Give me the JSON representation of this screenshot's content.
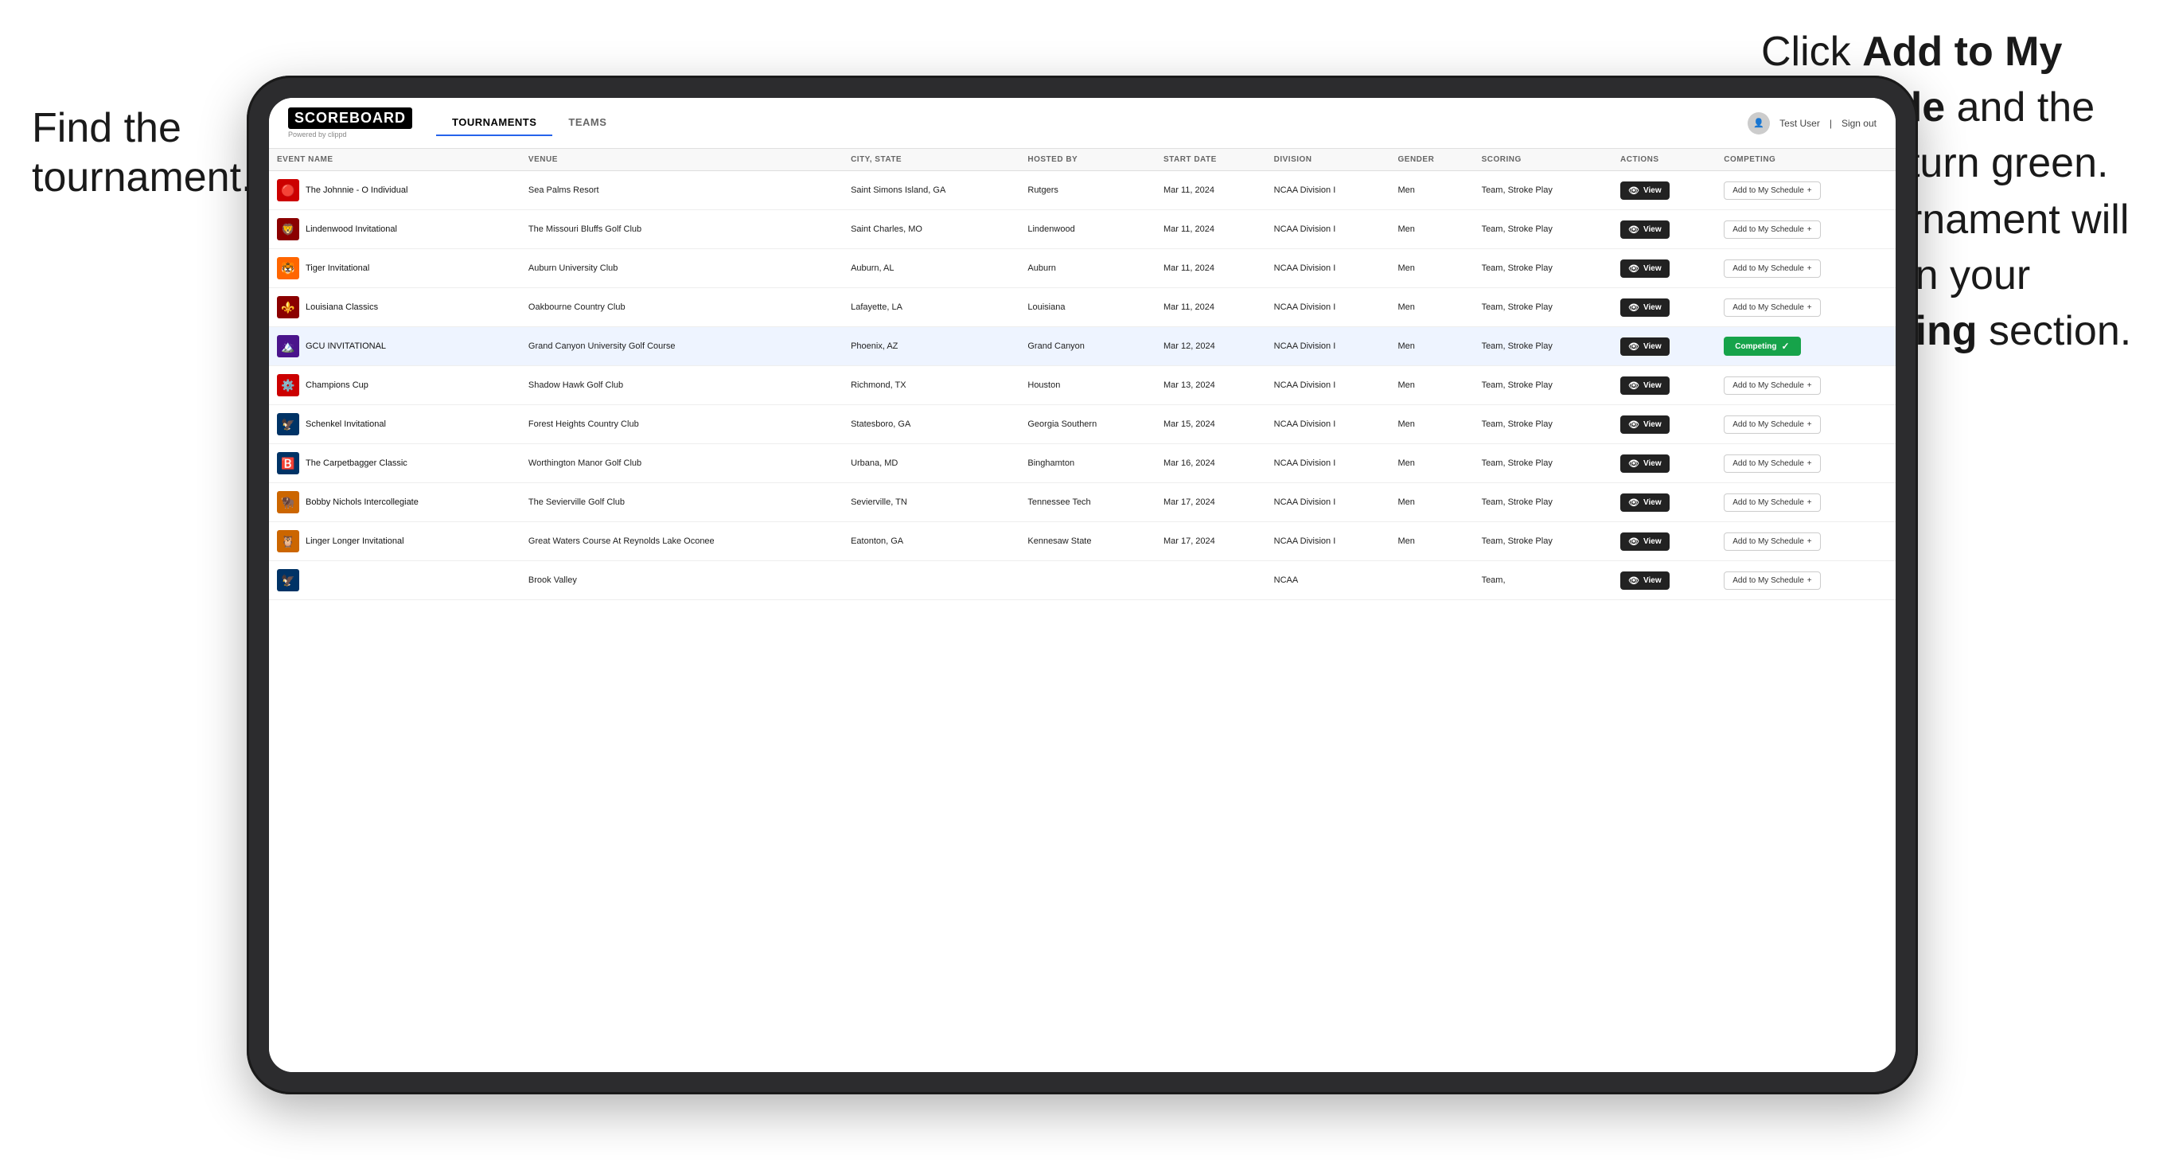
{
  "annotations": {
    "left": "Find the\ntournament.",
    "right_line1": "Click ",
    "right_bold1": "Add to My\nSchedule",
    "right_line2": " and the\nbox will turn green.\nThis tournament\nwill now be in\nyour ",
    "right_bold2": "Competing",
    "right_line3": " section."
  },
  "header": {
    "logo": "SCOREBOARD",
    "logo_sub": "Powered by clippd",
    "nav_tabs": [
      "TOURNAMENTS",
      "TEAMS"
    ],
    "active_tab": "TOURNAMENTS",
    "user": "Test User",
    "sign_out": "Sign out"
  },
  "table": {
    "columns": [
      "EVENT NAME",
      "VENUE",
      "CITY, STATE",
      "HOSTED BY",
      "START DATE",
      "DIVISION",
      "GENDER",
      "SCORING",
      "ACTIONS",
      "COMPETING"
    ],
    "rows": [
      {
        "logo_emoji": "🔴",
        "logo_bg": "#cc0000",
        "name": "The Johnnie - O Individual",
        "venue": "Sea Palms Resort",
        "city_state": "Saint Simons Island, GA",
        "hosted_by": "Rutgers",
        "start_date": "Mar 11, 2024",
        "division": "NCAA Division I",
        "gender": "Men",
        "scoring": "Team, Stroke Play",
        "status": "add",
        "highlighted": false
      },
      {
        "logo_emoji": "🦁",
        "logo_bg": "#8b0000",
        "name": "Lindenwood Invitational",
        "venue": "The Missouri Bluffs Golf Club",
        "city_state": "Saint Charles, MO",
        "hosted_by": "Lindenwood",
        "start_date": "Mar 11, 2024",
        "division": "NCAA Division I",
        "gender": "Men",
        "scoring": "Team, Stroke Play",
        "status": "add",
        "highlighted": false
      },
      {
        "logo_emoji": "🐯",
        "logo_bg": "#ff6600",
        "name": "Tiger Invitational",
        "venue": "Auburn University Club",
        "city_state": "Auburn, AL",
        "hosted_by": "Auburn",
        "start_date": "Mar 11, 2024",
        "division": "NCAA Division I",
        "gender": "Men",
        "scoring": "Team, Stroke Play",
        "status": "add",
        "highlighted": false
      },
      {
        "logo_emoji": "⚜️",
        "logo_bg": "#8b0000",
        "name": "Louisiana Classics",
        "venue": "Oakbourne Country Club",
        "city_state": "Lafayette, LA",
        "hosted_by": "Louisiana",
        "start_date": "Mar 11, 2024",
        "division": "NCAA Division I",
        "gender": "Men",
        "scoring": "Team, Stroke Play",
        "status": "add",
        "highlighted": false
      },
      {
        "logo_emoji": "🏔️",
        "logo_bg": "#4a148c",
        "name": "GCU INVITATIONAL",
        "venue": "Grand Canyon University Golf Course",
        "city_state": "Phoenix, AZ",
        "hosted_by": "Grand Canyon",
        "start_date": "Mar 12, 2024",
        "division": "NCAA Division I",
        "gender": "Men",
        "scoring": "Team, Stroke Play",
        "status": "competing",
        "highlighted": true
      },
      {
        "logo_emoji": "⚙️",
        "logo_bg": "#cc0000",
        "name": "Champions Cup",
        "venue": "Shadow Hawk Golf Club",
        "city_state": "Richmond, TX",
        "hosted_by": "Houston",
        "start_date": "Mar 13, 2024",
        "division": "NCAA Division I",
        "gender": "Men",
        "scoring": "Team, Stroke Play",
        "status": "add",
        "highlighted": false
      },
      {
        "logo_emoji": "🦅",
        "logo_bg": "#003366",
        "name": "Schenkel Invitational",
        "venue": "Forest Heights Country Club",
        "city_state": "Statesboro, GA",
        "hosted_by": "Georgia Southern",
        "start_date": "Mar 15, 2024",
        "division": "NCAA Division I",
        "gender": "Men",
        "scoring": "Team, Stroke Play",
        "status": "add",
        "highlighted": false
      },
      {
        "logo_emoji": "🅱️",
        "logo_bg": "#003366",
        "name": "The Carpetbagger Classic",
        "venue": "Worthington Manor Golf Club",
        "city_state": "Urbana, MD",
        "hosted_by": "Binghamton",
        "start_date": "Mar 16, 2024",
        "division": "NCAA Division I",
        "gender": "Men",
        "scoring": "Team, Stroke Play",
        "status": "add",
        "highlighted": false
      },
      {
        "logo_emoji": "🦬",
        "logo_bg": "#cc6600",
        "name": "Bobby Nichols Intercollegiate",
        "venue": "The Sevierville Golf Club",
        "city_state": "Sevierville, TN",
        "hosted_by": "Tennessee Tech",
        "start_date": "Mar 17, 2024",
        "division": "NCAA Division I",
        "gender": "Men",
        "scoring": "Team, Stroke Play",
        "status": "add",
        "highlighted": false
      },
      {
        "logo_emoji": "🦉",
        "logo_bg": "#cc6600",
        "name": "Linger Longer Invitational",
        "venue": "Great Waters Course At Reynolds Lake Oconee",
        "city_state": "Eatonton, GA",
        "hosted_by": "Kennesaw State",
        "start_date": "Mar 17, 2024",
        "division": "NCAA Division I",
        "gender": "Men",
        "scoring": "Team, Stroke Play",
        "status": "add",
        "highlighted": false
      },
      {
        "logo_emoji": "🦅",
        "logo_bg": "#003366",
        "name": "",
        "venue": "Brook Valley",
        "city_state": "",
        "hosted_by": "",
        "start_date": "",
        "division": "NCAA",
        "gender": "",
        "scoring": "Team,",
        "status": "add",
        "highlighted": false
      }
    ],
    "add_btn_label": "Add to My Schedule",
    "add_btn_plus": "+",
    "competing_label": "Competing",
    "competing_check": "✓",
    "view_label": "View",
    "view_icon": "👁"
  }
}
